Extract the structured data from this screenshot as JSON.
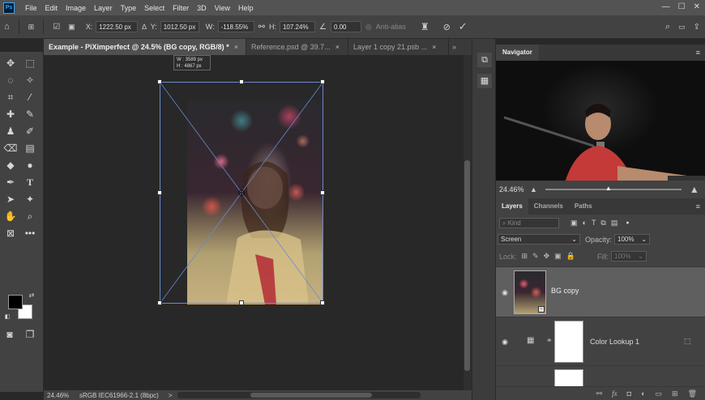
{
  "app": {
    "logo": "Ps"
  },
  "menu": [
    "File",
    "Edit",
    "Image",
    "Layer",
    "Type",
    "Select",
    "Filter",
    "3D",
    "View",
    "Help"
  ],
  "window_controls": [
    "—",
    "☐",
    "✕"
  ],
  "options": {
    "x_label": "X:",
    "x_value": "1222.50 px",
    "y_label": "Y:",
    "y_value": "1012.50 px",
    "w_label": "W:",
    "w_value": "-118.55%",
    "h_label": "H:",
    "h_value": "107.24%",
    "angle_value": "0.00",
    "antialias_label": "Anti-alias"
  },
  "tabs": [
    {
      "label": "Example - PiXimperfect @ 24.5% (BG copy, RGB/8) *",
      "close": "×"
    },
    {
      "label": "Reference.psd @ 39.7...",
      "close": "×"
    },
    {
      "label": "Layer 1 copy 21.psb ...",
      "close": "×"
    }
  ],
  "tabs_overflow": "»",
  "canvas": {
    "tooltip_w": "W :  3589 px",
    "tooltip_h": "H :  4867 px"
  },
  "status": {
    "zoom": "24.46%",
    "profile": "sRGB IEC61966-2.1 (8bpc)",
    "arrow": ">"
  },
  "navigator": {
    "title": "Navigator",
    "zoom": "24.46%"
  },
  "layers": {
    "tabs": [
      "Layers",
      "Channels",
      "Paths"
    ],
    "kind_placeholder": "Kind",
    "blend_mode": "Screen",
    "opacity_label": "Opacity:",
    "opacity_value": "100%",
    "lock_label": "Lock:",
    "fill_label": "Fill:",
    "fill_value": "100%",
    "items": [
      {
        "name": "BG copy",
        "visible": true,
        "selected": true
      },
      {
        "name": "Color Lookup 1",
        "visible": true,
        "selected": false
      }
    ]
  },
  "colors": {
    "accent": "#31a8ff",
    "transform_box": "#6a8ad0"
  }
}
